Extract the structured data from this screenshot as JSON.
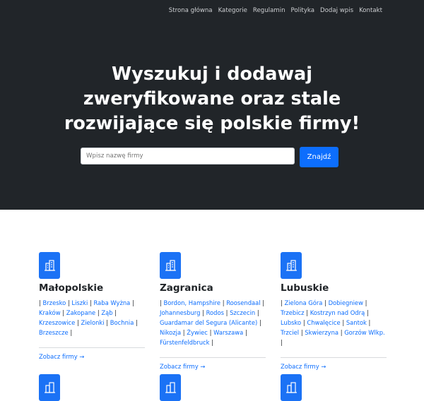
{
  "nav": [
    "Strona główna",
    "Kategorie",
    "Regulamin",
    "Polityka",
    "Dodaj wpis",
    "Kontakt"
  ],
  "hero": {
    "line1": "Wyszukuj i dodawaj",
    "line2": "zweryfikowane oraz stale",
    "line3": "rozwijające się polskie firmy!",
    "search_placeholder": "Wpisz nazwę firmy",
    "search_button": "Znajdź"
  },
  "categories": [
    {
      "icon": "building-icon",
      "title": "Małopolskie",
      "cities": [
        "Brzesko",
        "Liszki",
        "Raba Wyżna",
        "Kraków",
        "Zakopane",
        "Ząb",
        "Krzeszowice",
        "Zielonki",
        "Bochnia",
        "Brzeszcze"
      ],
      "more": "Zobacz firmy →"
    },
    {
      "icon": "building-icon",
      "title": "Zagranica",
      "cities": [
        "Bordon, Hampshire",
        "Roosendaal",
        "Johannesburg",
        "Rodos",
        "Szczecin",
        "Guardamar del Segura (Alicante)",
        "Nikozja",
        "Żywiec",
        "Warszawa",
        "Fürstenfeldbruck"
      ],
      "more": "Zobacz firmy →"
    },
    {
      "icon": "building-icon",
      "title": "Lubuskie",
      "cities": [
        "Zielona Góra",
        "Dobiegniew",
        "Trzebicz",
        "Kostrzyn nad Odrą",
        "Lubsko",
        "Chwalęcice",
        "Santok",
        "Trzciel",
        "Skwierzyna",
        "Gorzów Wlkp."
      ],
      "more": "Zobacz firmy →"
    }
  ],
  "colors": {
    "hero_bg": "#212529",
    "accent": "#0d6efd"
  }
}
